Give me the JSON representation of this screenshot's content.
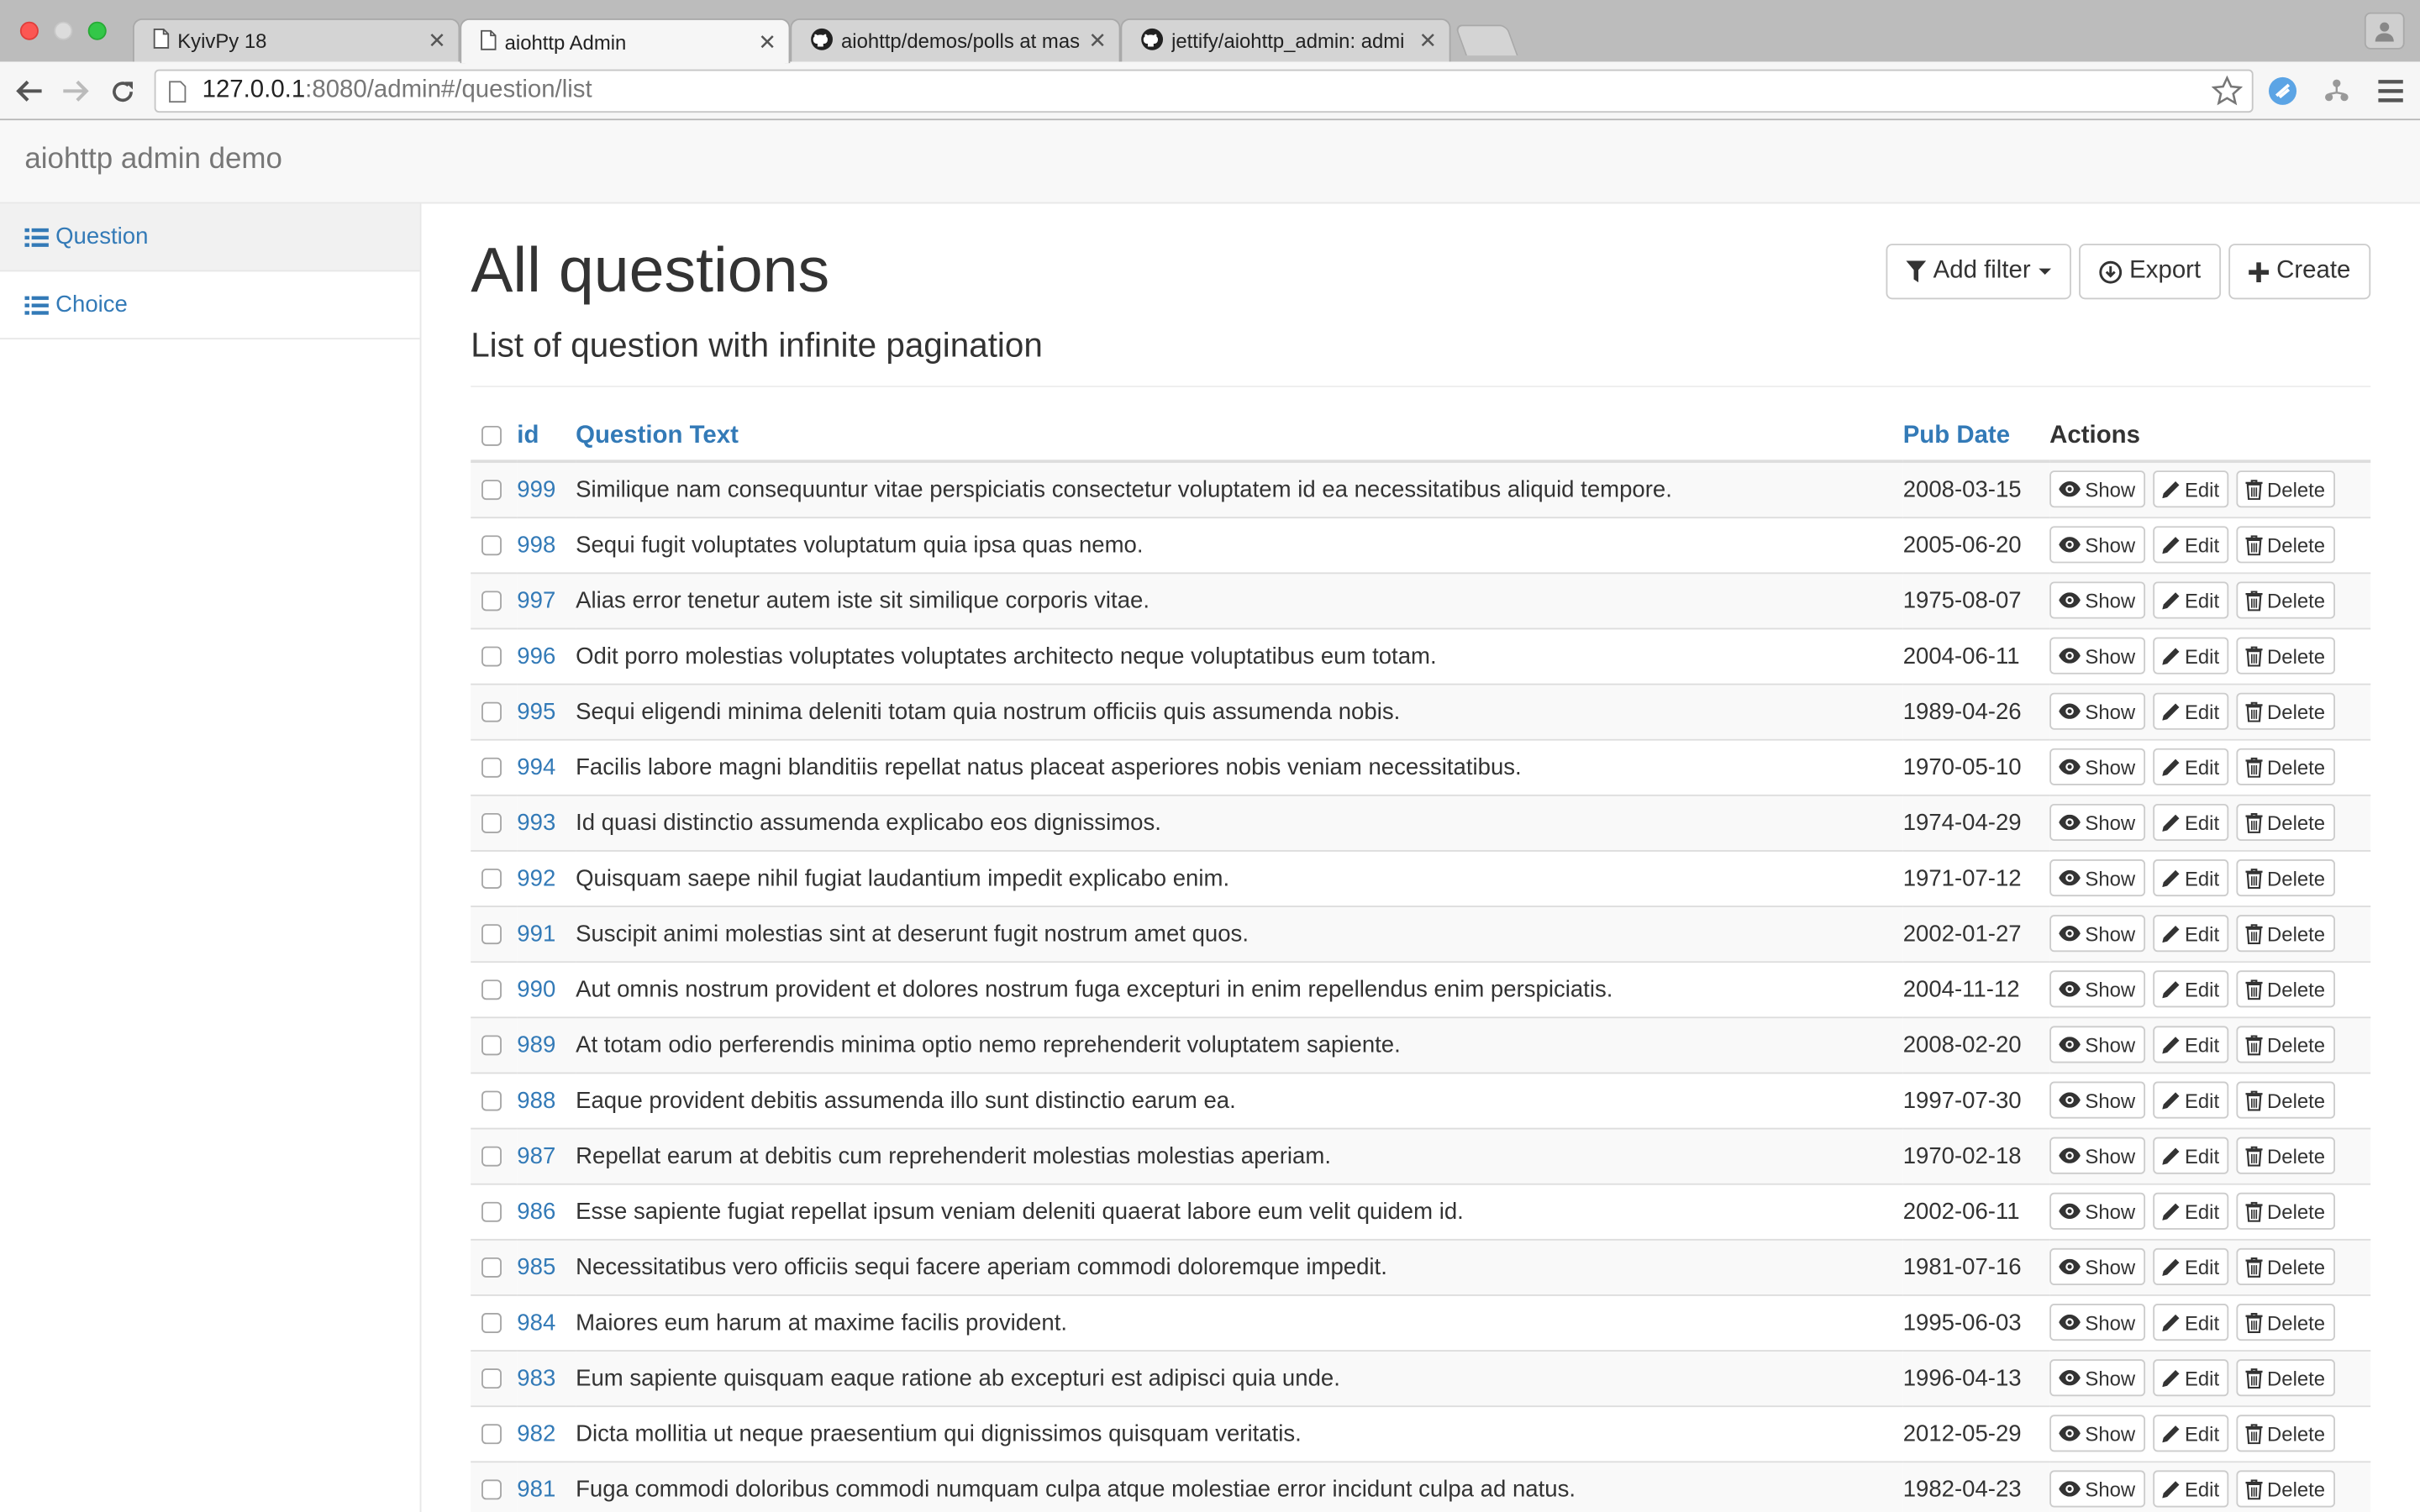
{
  "browser": {
    "tabs": [
      {
        "title": "KyivPy 18",
        "icon": "page-icon"
      },
      {
        "title": "aiohttp Admin",
        "icon": "page-icon"
      },
      {
        "title": "aiohttp/demos/polls at mas",
        "icon": "github-icon"
      },
      {
        "title": "jettify/aiohttp_admin: admi",
        "icon": "github-icon"
      }
    ],
    "url_host": "127.0.0.1",
    "url_rest": ":8080/admin#/question/list"
  },
  "app": {
    "brand": "aiohttp admin demo",
    "sidebar": [
      {
        "label": "Question",
        "icon": "list-icon"
      },
      {
        "label": "Choice",
        "icon": "list-icon"
      }
    ],
    "page": {
      "title": "All questions",
      "subtitle": "List of question with infinite pagination",
      "buttons": {
        "add_filter": "Add filter",
        "export": "Export",
        "create": "Create"
      }
    },
    "table": {
      "headers": {
        "id": "id",
        "text": "Question Text",
        "date": "Pub Date",
        "actions": "Actions"
      },
      "action_labels": {
        "show": "Show",
        "edit": "Edit",
        "delete": "Delete"
      },
      "rows": [
        {
          "id": "999",
          "text": "Similique nam consequuntur vitae perspiciatis consectetur voluptatem id ea necessitatibus aliquid tempore.",
          "date": "2008-03-15"
        },
        {
          "id": "998",
          "text": "Sequi fugit voluptates voluptatum quia ipsa quas nemo.",
          "date": "2005-06-20"
        },
        {
          "id": "997",
          "text": "Alias error tenetur autem iste sit similique corporis vitae.",
          "date": "1975-08-07"
        },
        {
          "id": "996",
          "text": "Odit porro molestias voluptates voluptates architecto neque voluptatibus eum totam.",
          "date": "2004-06-11"
        },
        {
          "id": "995",
          "text": "Sequi eligendi minima deleniti totam quia nostrum officiis quis assumenda nobis.",
          "date": "1989-04-26"
        },
        {
          "id": "994",
          "text": "Facilis labore magni blanditiis repellat natus placeat asperiores nobis veniam necessitatibus.",
          "date": "1970-05-10"
        },
        {
          "id": "993",
          "text": "Id quasi distinctio assumenda explicabo eos dignissimos.",
          "date": "1974-04-29"
        },
        {
          "id": "992",
          "text": "Quisquam saepe nihil fugiat laudantium impedit explicabo enim.",
          "date": "1971-07-12"
        },
        {
          "id": "991",
          "text": "Suscipit animi molestias sint at deserunt fugit nostrum amet quos.",
          "date": "2002-01-27"
        },
        {
          "id": "990",
          "text": "Aut omnis nostrum provident et dolores nostrum fuga excepturi in enim repellendus enim perspiciatis.",
          "date": "2004-11-12"
        },
        {
          "id": "989",
          "text": "At totam odio perferendis minima optio nemo reprehenderit voluptatem sapiente.",
          "date": "2008-02-20"
        },
        {
          "id": "988",
          "text": "Eaque provident debitis assumenda illo sunt distinctio earum ea.",
          "date": "1997-07-30"
        },
        {
          "id": "987",
          "text": "Repellat earum at debitis cum reprehenderit molestias molestias aperiam.",
          "date": "1970-02-18"
        },
        {
          "id": "986",
          "text": "Esse sapiente fugiat repellat ipsum veniam deleniti quaerat labore eum velit quidem id.",
          "date": "2002-06-11"
        },
        {
          "id": "985",
          "text": "Necessitatibus vero officiis sequi facere aperiam commodi doloremque impedit.",
          "date": "1981-07-16"
        },
        {
          "id": "984",
          "text": "Maiores eum harum at maxime facilis provident.",
          "date": "1995-06-03"
        },
        {
          "id": "983",
          "text": "Eum sapiente quisquam eaque ratione ab excepturi est adipisci quia unde.",
          "date": "1996-04-13"
        },
        {
          "id": "982",
          "text": "Dicta mollitia ut neque praesentium qui dignissimos quisquam veritatis.",
          "date": "2012-05-29"
        },
        {
          "id": "981",
          "text": "Fuga commodi doloribus commodi numquam culpa atque molestiae error incidunt culpa ad natus.",
          "date": "1982-04-23"
        }
      ]
    }
  },
  "colors": {
    "link": "#337ab7",
    "navbar_bg": "#f8f8f8",
    "stripe": "#f9f9f9"
  }
}
